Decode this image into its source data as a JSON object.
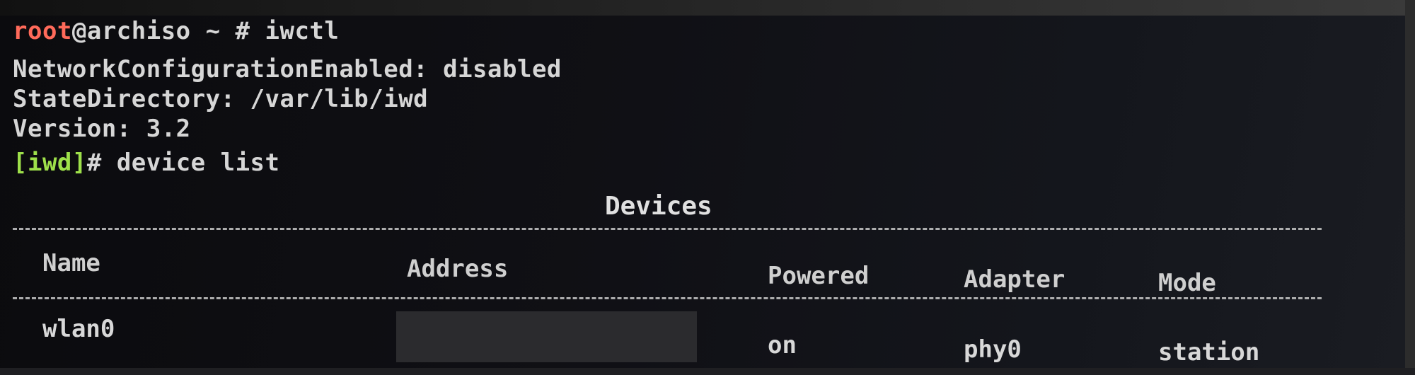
{
  "terminal": {
    "lines": [
      {
        "prompt_user": "root",
        "prompt_rest": "@archiso ~ # ",
        "command": "iwctl"
      },
      {
        "text": "NetworkConfigurationEnabled: disabled"
      },
      {
        "text": "StateDirectory: /var/lib/iwd"
      },
      {
        "text": "Version: 3.2"
      },
      {
        "prompt": "[iwd]",
        "prompt_suffix": "# ",
        "command": "device list"
      }
    ]
  },
  "devices_table": {
    "title": "Devices",
    "columns": [
      "Name",
      "Address",
      "Powered",
      "Adapter",
      "Mode"
    ],
    "rows": [
      {
        "name": "wlan0",
        "address": "",
        "powered": "on",
        "adapter": "phy0",
        "mode": "station"
      }
    ]
  },
  "colors": {
    "prompt_user": "#ff6a5a",
    "iwd_prompt": "#9ee04a",
    "text": "#d6d6d6",
    "background": "#0b0b0e"
  }
}
